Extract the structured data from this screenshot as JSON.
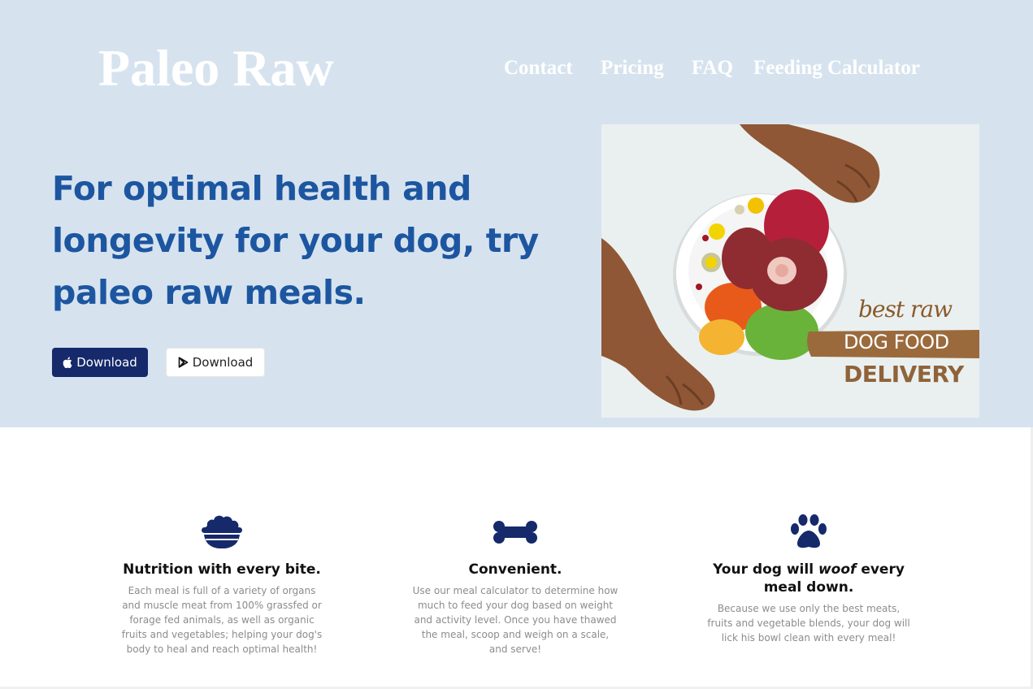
{
  "header": {
    "logo": "Paleo Raw",
    "nav": [
      "Contact",
      "Pricing",
      "FAQ",
      "Feeding Calculator"
    ]
  },
  "hero": {
    "headline": "For optimal health and longevity for your dog, try paleo raw meals.",
    "buttons": [
      {
        "label": "Download",
        "icon": "apple-icon"
      },
      {
        "label": "Download",
        "icon": "google-play-icon"
      }
    ],
    "image": {
      "line1": "best raw",
      "line2": "DOG FOOD",
      "line3": "DELIVERY"
    }
  },
  "features": [
    {
      "icon": "dog-bowl-icon",
      "title": "Nutrition with every bite.",
      "text": "Each meal is full of a variety of organs and muscle meat from 100% grassfed or forage fed animals, as well as organic fruits and vegetables; helping your dog's body to heal and reach optimal health!"
    },
    {
      "icon": "bone-icon",
      "title": "Convenient.",
      "text": "Use our meal calculator to determine how much to feed your dog based on weight and activity level. Once you have thawed the meal, scoop and weigh on a scale, and serve!"
    },
    {
      "icon": "paw-icon",
      "title_before": "Your dog will ",
      "title_emphasis": "woof",
      "title_after": " every meal down.",
      "text": "Because we use only the best meats, fruits and vegetable blends, your dog will lick his bowl clean with every meal!"
    }
  ],
  "colors": {
    "hero_background": "#d6e3ef",
    "headline": "#1d56a0",
    "primary_button": "#15296b",
    "icons": "#15296b"
  }
}
